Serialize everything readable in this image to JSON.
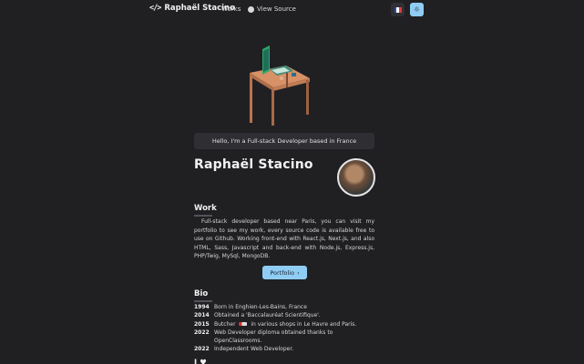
{
  "header": {
    "logo_mark": "</>",
    "logo_text": "Raphaël Stacino",
    "nav_work": "Works",
    "nav_source": "View Source",
    "theme_icon": "☼",
    "flag_colors": [
      "#1f4fb4",
      "#ffffff",
      "#e03a3e"
    ]
  },
  "intro": {
    "greeting": "Hello, I'm a Full-stack Developer based in France",
    "name": "Raphaël Stacino"
  },
  "work": {
    "title": "Work",
    "text": "Full-stack developer based near Paris, you can visit my portfolio to see my work, every source code is available free to use on Github. Working front-end with React.js, Next.js, and also HTML, Sass, Javascript and back-end with Node.js, Express.js, PHP/Twig, MySql, MongoDB.",
    "button_label": "Portfolio",
    "button_icon": "›"
  },
  "bio": {
    "title": "Bio",
    "entries": [
      {
        "year": "1994",
        "text": "Born in Enghien-Les-Bains, France"
      },
      {
        "year": "2014",
        "text": "Obtained a 'Baccalauréat Scientifique'."
      },
      {
        "year": "2015",
        "text_before": "Butcher",
        "text_after": "in various shops in Le Havre and Paris."
      },
      {
        "year": "2022",
        "text": "Web Developer diploma obtained thanks to OpenClassrooms."
      },
      {
        "year": "2022",
        "text": "Independent Web Developer."
      }
    ]
  },
  "next_section_title": "I ♥"
}
